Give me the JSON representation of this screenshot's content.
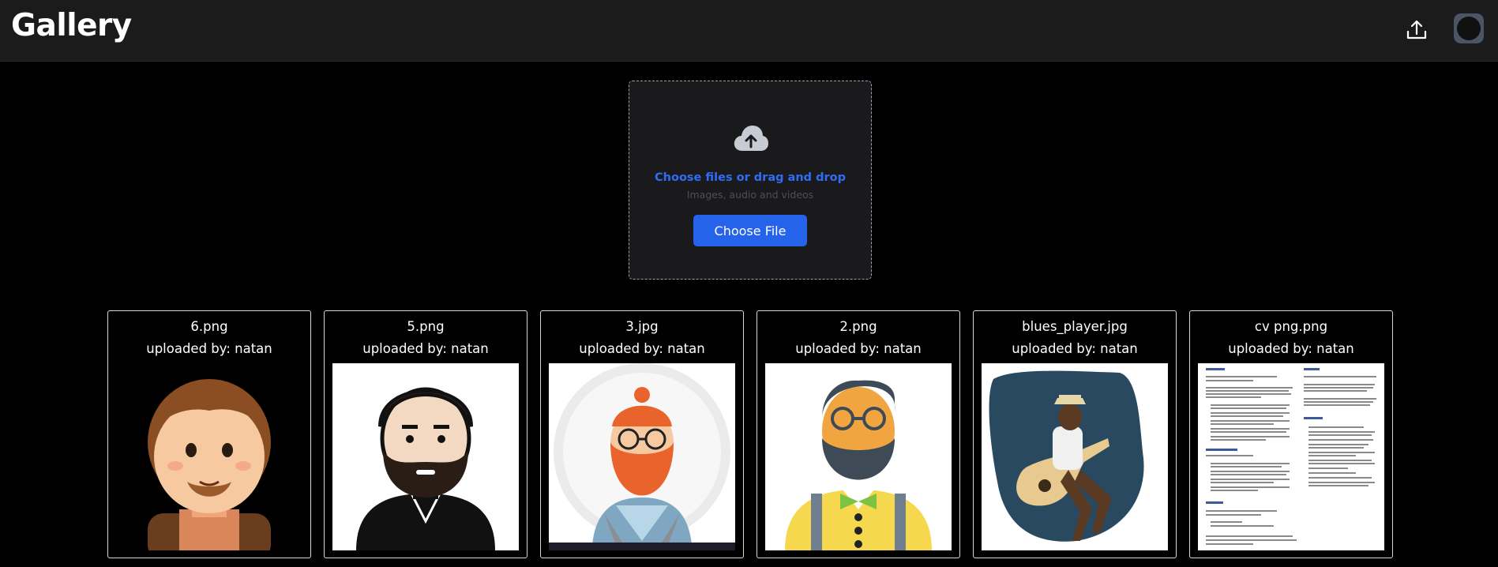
{
  "header": {
    "title": "Gallery"
  },
  "upload": {
    "title": "Choose files or drag and drop",
    "subtitle": "Images, audio and videos",
    "button_label": "Choose File"
  },
  "gallery": {
    "items": [
      {
        "name": "6.png",
        "uploader": "uploaded by: natan"
      },
      {
        "name": "5.png",
        "uploader": "uploaded by: natan"
      },
      {
        "name": "3.jpg",
        "uploader": "uploaded by: natan"
      },
      {
        "name": "2.png",
        "uploader": "uploaded by: natan"
      },
      {
        "name": "blues_player.jpg",
        "uploader": "uploaded by: natan"
      },
      {
        "name": "cv png.png",
        "uploader": "uploaded by: natan"
      }
    ]
  },
  "colors": {
    "accent": "#2563eb",
    "header_bg": "#1b1b1b",
    "background": "#000000"
  }
}
